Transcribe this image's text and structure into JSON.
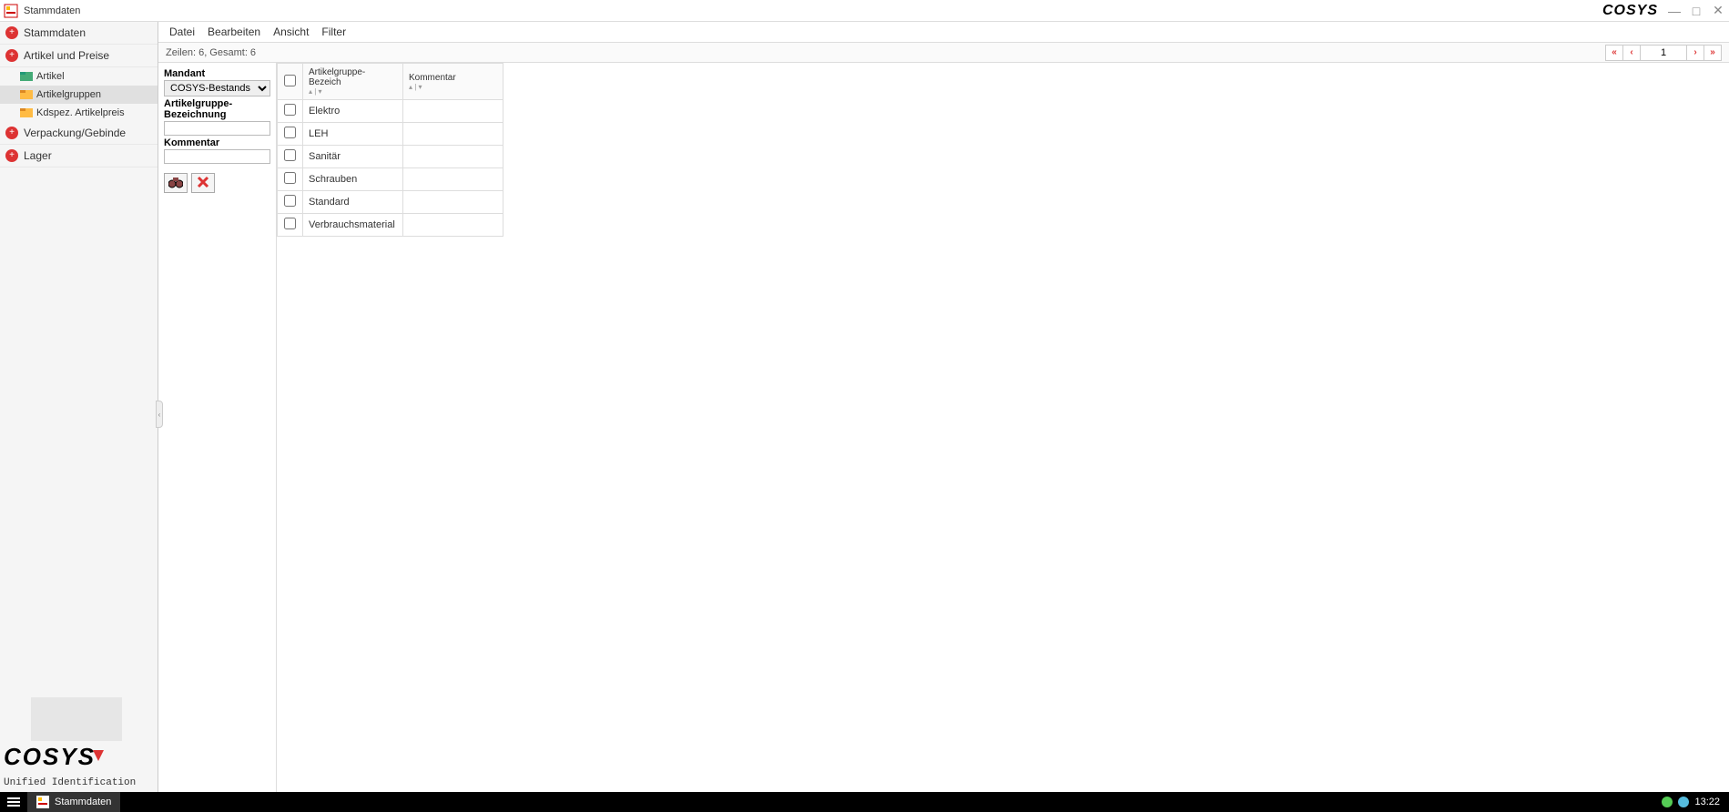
{
  "titlebar": {
    "title": "Stammdaten",
    "logo": "COSYS"
  },
  "sidebar": {
    "items": [
      {
        "label": "Stammdaten",
        "expandable": true
      },
      {
        "label": "Artikel und Preise",
        "expandable": true
      }
    ],
    "subitems": [
      {
        "label": "Artikel"
      },
      {
        "label": "Artikelgruppen"
      },
      {
        "label": "Kdspez. Artikelpreis"
      }
    ],
    "items2": [
      {
        "label": "Verpackung/Gebinde"
      },
      {
        "label": "Lager"
      }
    ],
    "footer": {
      "logo": "COSYS",
      "tagline": "Unified Identification"
    }
  },
  "menubar": {
    "items": [
      "Datei",
      "Bearbeiten",
      "Ansicht",
      "Filter"
    ]
  },
  "statusbar": {
    "text": "Zeilen: 6, Gesamt: 6",
    "page": "1"
  },
  "filter": {
    "mandant_label": "Mandant",
    "mandant_value": "COSYS-Bestands",
    "artgrp_label": "Artikelgruppe-Bezeichnung",
    "kommentar_label": "Kommentar"
  },
  "table": {
    "headers": {
      "artikelgruppe": "Artikelgruppe-Bezeich",
      "kommentar": "Kommentar"
    },
    "rows": [
      {
        "name": "Elektro",
        "kommentar": ""
      },
      {
        "name": "LEH",
        "kommentar": ""
      },
      {
        "name": "Sanitär",
        "kommentar": ""
      },
      {
        "name": "Schrauben",
        "kommentar": ""
      },
      {
        "name": "Standard",
        "kommentar": ""
      },
      {
        "name": "Verbrauchsmaterial",
        "kommentar": ""
      }
    ]
  },
  "taskbar": {
    "app": "Stammdaten",
    "clock": "13:22"
  }
}
